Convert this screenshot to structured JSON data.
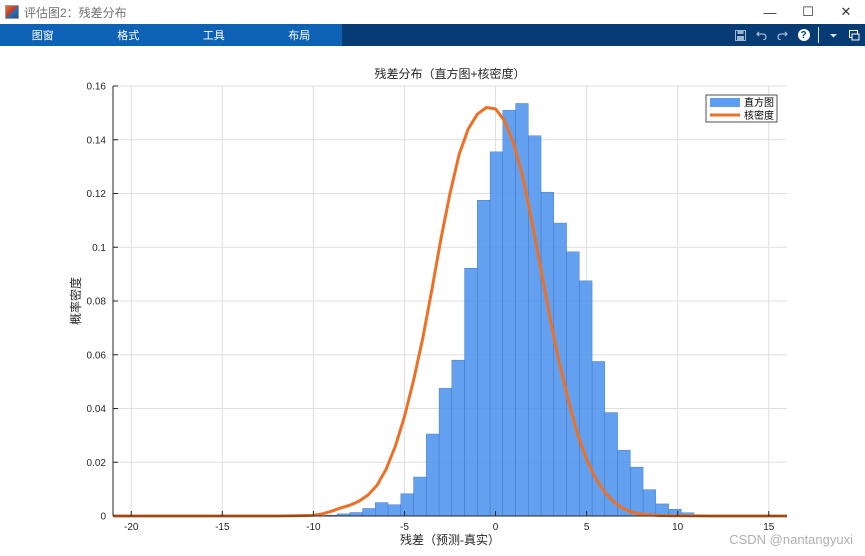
{
  "window": {
    "title": "评估图2：残差分布",
    "controls": {
      "minimize": "—",
      "maximize": "☐",
      "close": "✕"
    }
  },
  "toolstrip": {
    "tabs": [
      {
        "label": "图窗"
      },
      {
        "label": "格式"
      },
      {
        "label": "工具"
      },
      {
        "label": "布局"
      }
    ],
    "quick_access": [
      "save-icon",
      "undo-icon",
      "redo-icon",
      "help-icon",
      "collapse-icon",
      "dock-icon"
    ],
    "help_glyph": "?"
  },
  "chart_data": {
    "type": "bar",
    "title": "残差分布（直方图+核密度）",
    "xlabel": "残差（预测-真实）",
    "ylabel": "概率密度",
    "xlim": [
      -21,
      16
    ],
    "ylim": [
      0,
      0.16
    ],
    "xticks": [
      -20,
      -15,
      -10,
      -5,
      0,
      5,
      10,
      15
    ],
    "yticks": [
      0,
      0.02,
      0.04,
      0.06,
      0.08,
      0.1,
      0.12,
      0.14,
      0.16
    ],
    "grid": true,
    "legend_position": "top-right",
    "histogram": {
      "name": "直方图",
      "color": "#4d94ee",
      "bin_width": 0.7,
      "bin_start": -9.4,
      "values": [
        0.0003,
        0.0008,
        0.0013,
        0.0028,
        0.005,
        0.0042,
        0.0083,
        0.0145,
        0.0305,
        0.0475,
        0.058,
        0.0922,
        0.1175,
        0.1355,
        0.151,
        0.1535,
        0.1415,
        0.1205,
        0.109,
        0.0983,
        0.0875,
        0.0575,
        0.0385,
        0.0245,
        0.0182,
        0.0098,
        0.0045,
        0.0025,
        0.0012,
        0.0004
      ]
    },
    "kde": {
      "name": "核密度",
      "color": "#ec7126",
      "x": [
        -21,
        -18,
        -15,
        -12,
        -11,
        -10,
        -9.5,
        -9,
        -8.5,
        -8,
        -7.5,
        -7,
        -6.5,
        -6,
        -5.5,
        -5,
        -4.5,
        -4,
        -3.5,
        -3,
        -2.5,
        -2,
        -1.5,
        -1,
        -0.5,
        0,
        0.5,
        1,
        1.5,
        2,
        2.5,
        3,
        3.5,
        4,
        4.5,
        5,
        5.5,
        6,
        6.5,
        7,
        7.5,
        8,
        9,
        10,
        12,
        15,
        16
      ],
      "y": [
        0,
        0,
        0,
        0,
        0.0001,
        0.0003,
        0.0008,
        0.0018,
        0.003,
        0.004,
        0.0055,
        0.0078,
        0.0115,
        0.0175,
        0.026,
        0.037,
        0.0505,
        0.066,
        0.084,
        0.103,
        0.12,
        0.1345,
        0.144,
        0.1495,
        0.152,
        0.1515,
        0.147,
        0.1385,
        0.126,
        0.1095,
        0.0915,
        0.0735,
        0.057,
        0.043,
        0.0305,
        0.021,
        0.014,
        0.0088,
        0.0052,
        0.0028,
        0.0014,
        0.0007,
        0.0002,
        0.0001,
        0,
        0,
        0
      ]
    }
  },
  "watermark": "CSDN @nantangyuxi"
}
